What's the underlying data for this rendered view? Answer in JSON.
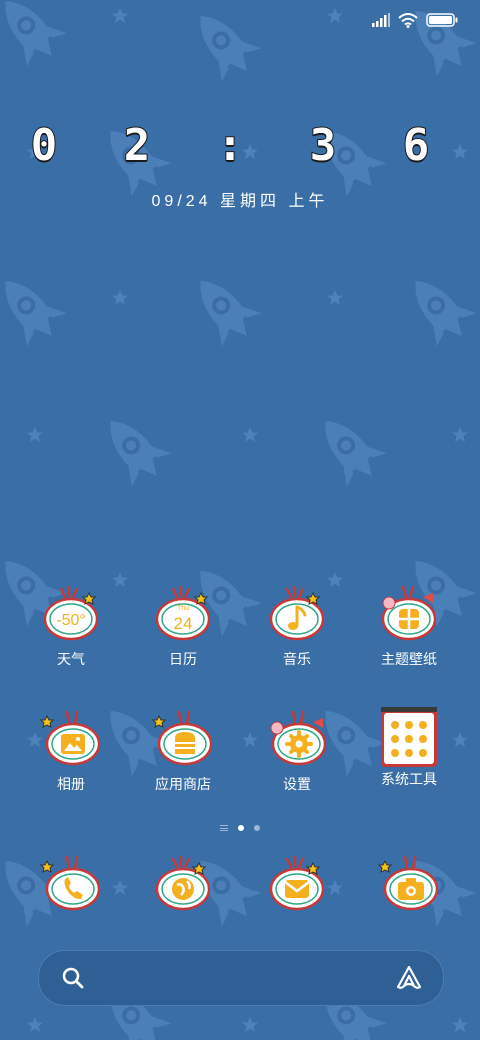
{
  "status": {
    "icons": [
      "signal-icon",
      "wifi-icon",
      "battery-icon"
    ]
  },
  "clock": {
    "time": "0 2 : 3 6",
    "date": "09/24  星期四  上午"
  },
  "apps": [
    {
      "label": "天气",
      "icon": "weather-icon",
      "badge": "-50°"
    },
    {
      "label": "日历",
      "icon": "calendar-icon",
      "badge": "24",
      "day": "Thu"
    },
    {
      "label": "音乐",
      "icon": "music-icon"
    },
    {
      "label": "主题壁纸",
      "icon": "theme-icon"
    },
    {
      "label": "相册",
      "icon": "gallery-icon"
    },
    {
      "label": "应用商店",
      "icon": "app-store-icon"
    },
    {
      "label": "设置",
      "icon": "settings-icon"
    },
    {
      "label": "系统工具",
      "icon": "folder-icon"
    }
  ],
  "dock": [
    {
      "icon": "phone-icon"
    },
    {
      "icon": "browser-icon"
    },
    {
      "icon": "messages-icon"
    },
    {
      "icon": "camera-icon"
    }
  ],
  "pager": {
    "current": 1,
    "count": 2
  },
  "colors": {
    "background": "#3a6ea6",
    "accent": "#f5b020",
    "outline": "#c43a3a"
  }
}
